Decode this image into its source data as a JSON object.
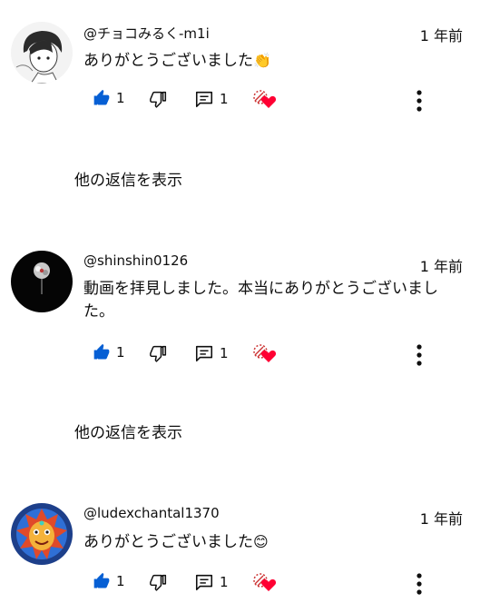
{
  "comments": [
    {
      "author": "@チョコみるく-m1i",
      "time": "1 年前",
      "text": "ありがとうございました",
      "emoji": "👏",
      "likes": "1",
      "replies_count": "1",
      "show_replies": "他の返信を表示",
      "avatar": "manga-character-avatar"
    },
    {
      "author": "@shinshin0126",
      "time": "1 年前",
      "text": "動画を拝見しました。本当にありがとうございました。",
      "emoji": "",
      "likes": "1",
      "replies_count": "1",
      "show_replies": "他の返信を表示",
      "avatar": "dark-flower-avatar"
    },
    {
      "author": "@ludexchantal1370",
      "time": "1 年前",
      "text": "ありがとうございました",
      "emoji": "😊",
      "likes": "1",
      "replies_count": "1",
      "avatar": "colorful-mask-avatar"
    }
  ],
  "colors": {
    "like_blue": "#065fd4",
    "heart_red": "#ff0033",
    "text": "#0f0f0f"
  }
}
